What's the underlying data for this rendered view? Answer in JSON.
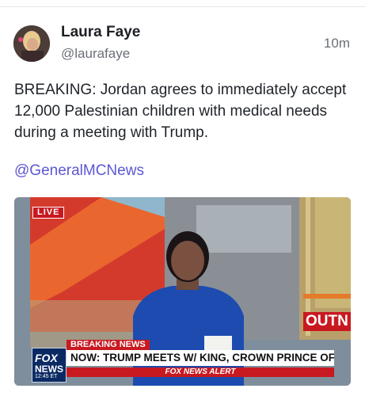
{
  "post": {
    "author_name": "Laura Faye",
    "author_handle": "@laurafaye",
    "timestamp": "10m",
    "body": "BREAKING: Jordan agrees to immediately accept 12,000 Palestinian children with medical needs during a meeting with Trump.",
    "mention": "@GeneralMCNews"
  },
  "media": {
    "live_label": "LIVE",
    "breaking_label": "BREAKING NEWS",
    "headline": "NOW: TRUMP MEETS W/ KING, CROWN PRINCE OF JORDAN",
    "alert_label": "FOX NEWS ALERT",
    "logo_line1": "FOX",
    "logo_line2": "NEWS",
    "logo_time": "12:45 ET",
    "side_text": "OUTN"
  },
  "colors": {
    "mention": "#5b57d6",
    "fox_red": "#c81921",
    "fox_navy": "#0b2a63"
  }
}
